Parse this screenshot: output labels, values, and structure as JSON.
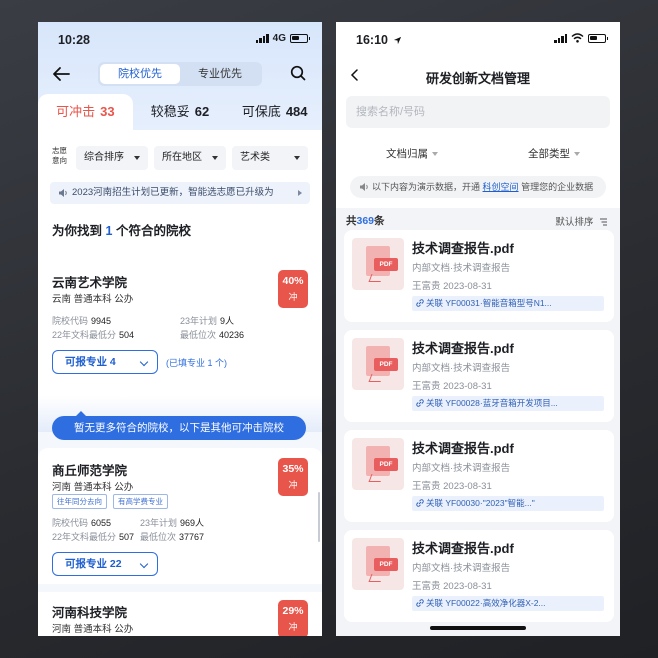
{
  "left": {
    "status": {
      "time": "10:28",
      "network": "4G"
    },
    "nav": {
      "seg_active": "院校优先",
      "seg_inactive": "专业优先"
    },
    "tabs": [
      {
        "label": "可冲击",
        "count": "33"
      },
      {
        "label": "较稳妥",
        "count": "62"
      },
      {
        "label": "可保底",
        "count": "484"
      }
    ],
    "filters": {
      "label": "志愿意向",
      "chips": [
        "综合排序",
        "所在地区",
        "艺术类"
      ]
    },
    "notice": "2023河南招生计划已更新，智能选志愿已升级为",
    "found": {
      "prefix": "为你找到",
      "num": "1",
      "suffix": "个符合的院校"
    },
    "schools": [
      {
        "name": "云南艺术学院",
        "meta": "云南 普通本科 公办",
        "percent": "40%",
        "level": "冲",
        "code_label": "院校代码",
        "code": "9945",
        "plan_label": "23年计划",
        "plan": "9人",
        "score_label": "22年文科最低分",
        "score": "504",
        "rank_label": "最低位次",
        "rank": "40236",
        "major_btn": "可报专业 4",
        "filled": "(已填专业 1 个)"
      },
      {
        "name": "商丘师范学院",
        "meta": "河南 普通本科 公办",
        "percent": "35%",
        "level": "冲",
        "tags": [
          "往年同分去向",
          "有高学费专业"
        ],
        "code_label": "院校代码",
        "code": "6055",
        "plan_label": "23年计划",
        "plan": "969人",
        "score_label": "22年文科最低分",
        "score": "507",
        "rank_label": "最低位次",
        "rank": "37767",
        "major_btn": "可报专业 22"
      },
      {
        "name": "河南科技学院",
        "meta": "河南 普通本科 公办",
        "percent": "29%",
        "level": "冲"
      }
    ],
    "pill": "暂无更多符合的院校，以下是其他可冲击院校"
  },
  "right": {
    "status": {
      "time": "16:10"
    },
    "title": "研发创新文档管理",
    "search_placeholder": "搜索名称/号码",
    "filters": [
      "文档归属",
      "全部类型"
    ],
    "notice": {
      "before": "以下内容为演示数据，开通",
      "link": "科创空间",
      "after": "管理您的企业数据"
    },
    "count": {
      "prefix": "共",
      "num": "369",
      "suffix": "条"
    },
    "sort": "默认排序",
    "docs": [
      {
        "name": "技术调查报告.pdf",
        "category": "内部文档·技术调查报告",
        "author": "王富贵 2023-08-31",
        "relation": "关联 YF00031·智能音箱型号N1..."
      },
      {
        "name": "技术调查报告.pdf",
        "category": "内部文档·技术调查报告",
        "author": "王富贵 2023-08-31",
        "relation": "关联 YF00028·蓝牙音箱开发项目..."
      },
      {
        "name": "技术调查报告.pdf",
        "category": "内部文档·技术调查报告",
        "author": "王富贵 2023-08-31",
        "relation": "关联 YF00030·\"2023\"智能...\""
      },
      {
        "name": "技术调查报告.pdf",
        "category": "内部文档·技术调查报告",
        "author": "王富贵 2023-08-31",
        "relation": "关联 YF00022·高效净化器X-2..."
      }
    ],
    "pdf_label": "PDF"
  }
}
